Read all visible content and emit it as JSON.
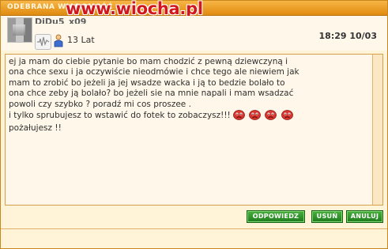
{
  "window": {
    "title": "ODEBRANA WIADOMOŚĆ"
  },
  "watermark": {
    "text": "www.wiocha.pl"
  },
  "header": {
    "username": "DiDu5_x09",
    "age": "13 Lat",
    "time": "18:29 10/03",
    "icons": [
      "avatar",
      "wave-icon",
      "person-icon"
    ]
  },
  "message": {
    "lines": [
      "ej ja mam do ciebie pytanie bo mam chodzić z pewną dziewczyną i",
      "ona chce sexu i ja oczywiście nieodmówie i chce tego ale niewiem jak",
      "mam to zrobić bo jeżeli ja jej wsadze wacka i ją to bedzie bolało to",
      "ona chce zeby ją bolało? bo jeżeli sie na mnie napali i mam wsadzać",
      "powoli czy szybko ? poradź mi cos proszee .",
      "i tylko sprubujesz to wstawić do fotek to zobaczysz!!!",
      "pożałujesz !!"
    ],
    "smiley_count": 4
  },
  "buttons": {
    "reply": "ODPOWIEDZ",
    "delete": "USUŃ",
    "cancel": "ANULUJ"
  },
  "colors": {
    "titlebar": "#e08b10",
    "watermark": "#d2171d",
    "button": "#2f8f2a",
    "background": "#fff3d8"
  }
}
